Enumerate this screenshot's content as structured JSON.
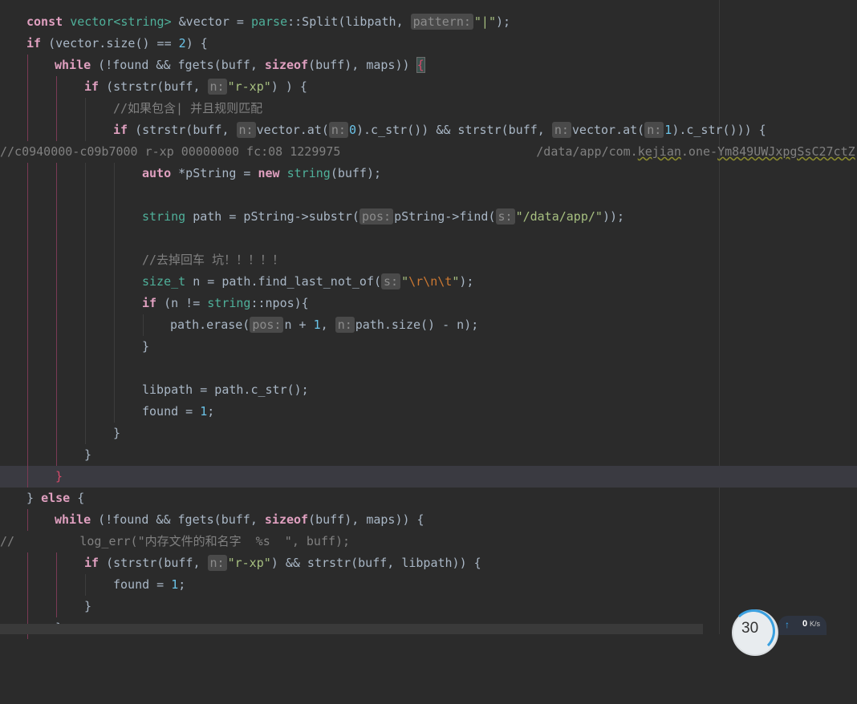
{
  "hints": {
    "pattern": "pattern:",
    "n": "n:",
    "pos": "pos:",
    "s": "s:"
  },
  "code": {
    "l1": {
      "const": "const",
      "vector": "vector",
      "lt": "<",
      "string": "string",
      "gt": ">",
      "rest": " &vector = ",
      "parse": "parse",
      "split": "::Split(libpath, ",
      "str": "\"|\"",
      "end": ");"
    },
    "l2": {
      "if": "if",
      "rest": " (vector.size() == ",
      "num": "2",
      "end": ") {"
    },
    "l3": {
      "while": "while",
      "a": " (!found && fgets(buff, ",
      "sizeof": "sizeof",
      "b": "(buff), maps)) ",
      "brace": "{"
    },
    "l4": {
      "if": "if",
      "a": " (strstr(buff, ",
      "str": "\"r-xp\"",
      "end": ") ) {"
    },
    "l5": {
      "cmt": "//如果包含| 并且规则匹配"
    },
    "l6": {
      "if": "if",
      "a": " (strstr(buff, ",
      "b": "vector.at(",
      "n0": "0",
      "c": ").c_str()) && strstr(buff, ",
      "d": "vector.at(",
      "n1": "1",
      "e": ").c_str())) {"
    },
    "l7": {
      "cmt": "//c0940000-c09b7000 r-xp 00000000 fc:08 1229975                           /data/app/com.",
      "kejian": "kejian",
      "rest": ".one-",
      "tail": "Ym849UWJxpgSsC27ctZ"
    },
    "l8": {
      "auto": "auto",
      "a": " *pString = ",
      "new": "new",
      "sp": " ",
      "string": "string",
      "end": "(buff);"
    },
    "l9": {
      "string": "string",
      "a": " path = pString->substr(",
      "b": "pString->find(",
      "str": "\"/data/app/\"",
      "end": "));"
    },
    "l10": {
      "cmt": "//去掉回车 坑！！！！！"
    },
    "l11": {
      "size_t": "size_t",
      "a": " n = path.find_last_not_of(",
      "q1": "\"",
      "esc": "\\r\\n\\t",
      "q2": "\"",
      "end": ");"
    },
    "l12": {
      "if": "if",
      "a": " (n != ",
      "string": "string",
      "b": "::npos){"
    },
    "l13": {
      "a": "path.erase(",
      "b": "n + ",
      "num": "1",
      "c": ", ",
      "d": "path.size() - n);"
    },
    "l14": {
      "brace": "}"
    },
    "l15": {
      "a": "libpath = path.c_str();"
    },
    "l16": {
      "a": "found = ",
      "num": "1",
      "end": ";"
    },
    "l17": {
      "brace": "}"
    },
    "l18": {
      "brace": "}"
    },
    "l19": {
      "brace": "}"
    },
    "l20": {
      "a": "} ",
      "else": "else",
      "b": " {"
    },
    "l21": {
      "while": "while",
      "a": " (!found && fgets(buff, ",
      "sizeof": "sizeof",
      "b": "(buff), maps)) {"
    },
    "l22": {
      "cmt": "//         log_err(\"内存文件的和名字  %s  \", buff);"
    },
    "l23": {
      "if": "if",
      "a": " (strstr(buff, ",
      "str": "\"r-xp\"",
      "b": ") && strstr(buff, libpath)) {"
    },
    "l24": {
      "a": "found = ",
      "num": "1",
      "end": ";"
    },
    "l25": {
      "brace": "}"
    },
    "l26": {
      "brace": "}"
    }
  },
  "widget": {
    "percent": "30",
    "arrow": "↑",
    "speed": "0",
    "unit": "K/s"
  }
}
